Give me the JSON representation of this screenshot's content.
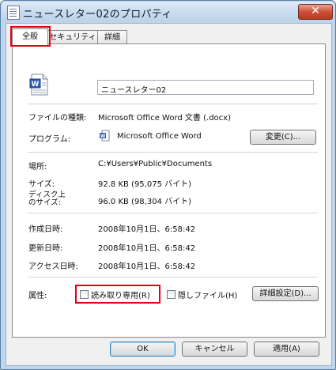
{
  "window": {
    "title": "ニュースレター02のプロパティ",
    "close_label": "✕"
  },
  "tabs": [
    {
      "label": "全般"
    },
    {
      "label": "セキュリティ"
    },
    {
      "label": "詳細"
    }
  ],
  "general": {
    "file_name": "ニュースレター02",
    "file_type_label": "ファイルの種類:",
    "file_type_value": "Microsoft Office Word 文書 (.docx)",
    "program_label": "プログラム:",
    "program_value": "Microsoft Office Word",
    "change_button": "変更(C)...",
    "location_label": "場所:",
    "location_value": "C:¥Users¥Public¥Documents",
    "size_label": "サイズ:",
    "size_value": "92.8 KB (95,075 バイト)",
    "disk_size_label_1": "ディスク上",
    "disk_size_label_2": "のサイズ:",
    "disk_size_value": "96.0 KB (98,304 バイト)",
    "created_label": "作成日時:",
    "created_value": "2008年10月1日、6:58:42",
    "modified_label": "更新日時:",
    "modified_value": "2008年10月1日、6:58:42",
    "accessed_label": "アクセス日時:",
    "accessed_value": "2008年10月1日、6:58:42",
    "attributes_label": "属性:",
    "readonly_label": "読み取り専用(R)",
    "readonly_checked": false,
    "hidden_label": "隠しファイル(H)",
    "hidden_checked": false,
    "advanced_button": "詳細設定(D)..."
  },
  "footer": {
    "ok": "OK",
    "cancel": "キャンセル",
    "apply": "適用(A)"
  },
  "colors": {
    "highlight_border": "#e60012",
    "title_bar": "#c8dbef"
  }
}
